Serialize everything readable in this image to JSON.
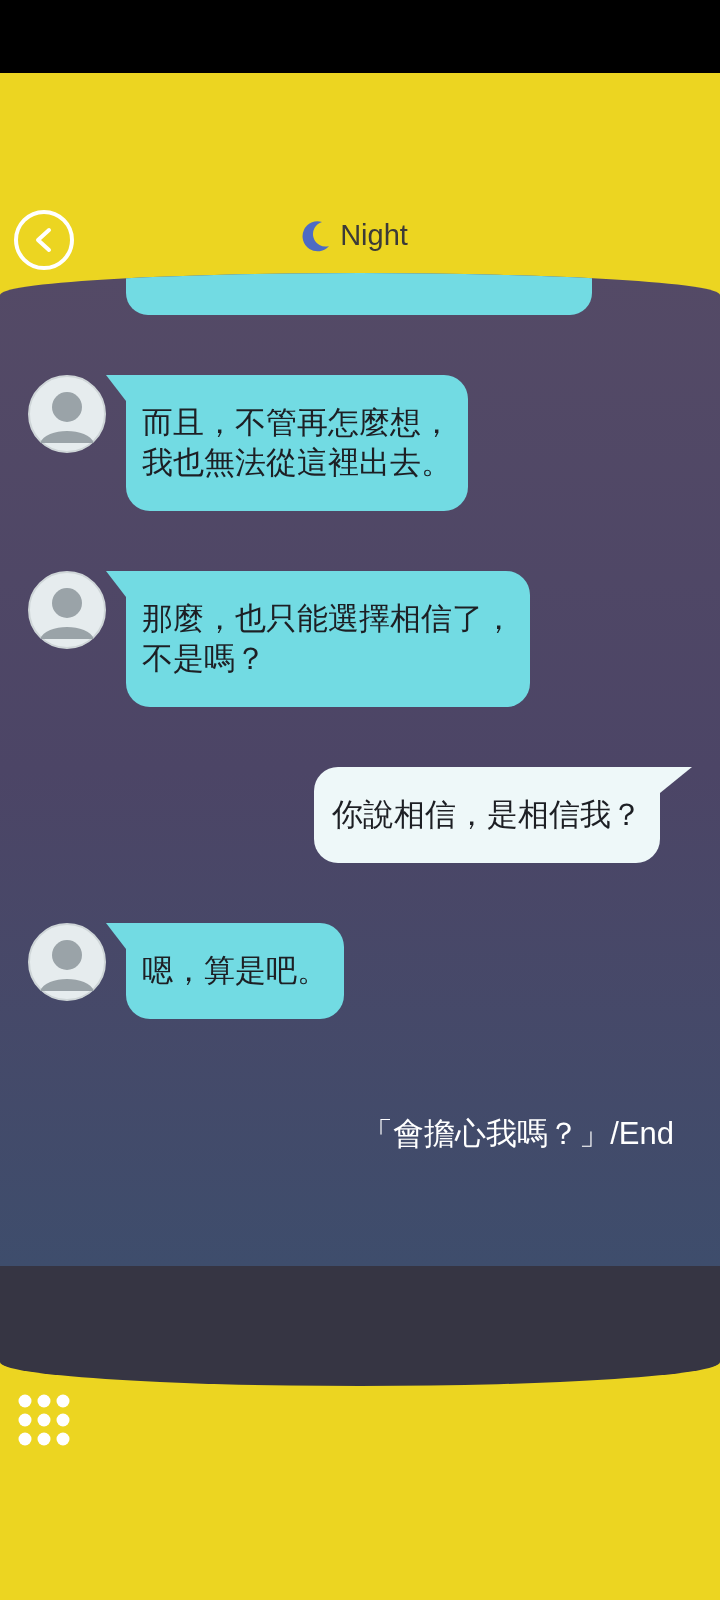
{
  "header": {
    "title": "Night"
  },
  "messages": [
    {
      "kind": "cut"
    },
    {
      "kind": "npc",
      "lines": [
        "而且，不管再怎麼想，",
        "我也無法從這裡出去。"
      ]
    },
    {
      "kind": "npc",
      "lines": [
        "那麼，也只能選擇相信了，",
        "不是嗎？"
      ]
    },
    {
      "kind": "player",
      "lines": [
        "你說相信，是相信我？"
      ]
    },
    {
      "kind": "npc",
      "lines": [
        "嗯，算是吧。"
      ]
    }
  ],
  "ending": "「會擔心我嗎？」/End"
}
